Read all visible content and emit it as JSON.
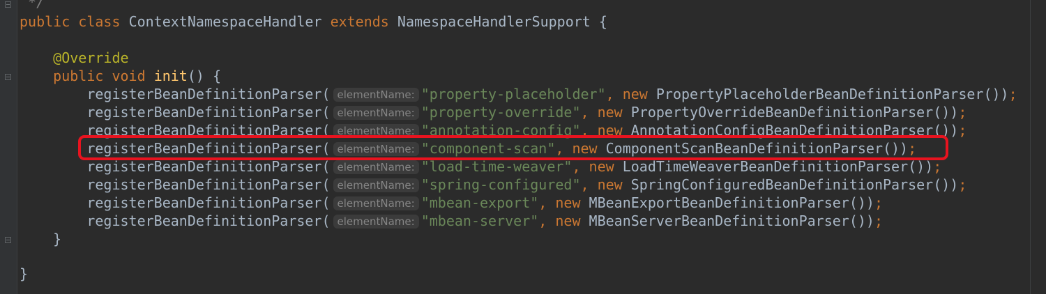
{
  "editor": {
    "lines": [
      {
        "kind": "comment",
        "text": " */"
      },
      {
        "kind": "class_decl",
        "kw_public": "public",
        "kw_class": "class",
        "class_name": "ContextNamespaceHandler",
        "kw_extends": "extends",
        "parent": "NamespaceHandlerSupport",
        "brace": "{"
      },
      {
        "kind": "blank"
      },
      {
        "kind": "annotation",
        "text": "@Override"
      },
      {
        "kind": "method_decl",
        "kw_public": "public",
        "kw_void": "void",
        "name": "init",
        "rest": "() {"
      },
      {
        "kind": "call",
        "method": "registerBeanDefinitionParser(",
        "hint": "elementName:",
        "arg": "\"property-placeholder\"",
        "comma": ",",
        "kw_new": "new",
        "ctor": "PropertyPlaceholderBeanDefinitionParser())",
        "semi": ";"
      },
      {
        "kind": "call",
        "method": "registerBeanDefinitionParser(",
        "hint": "elementName:",
        "arg": "\"property-override\"",
        "comma": ",",
        "kw_new": "new",
        "ctor": "PropertyOverrideBeanDefinitionParser())",
        "semi": ";"
      },
      {
        "kind": "call",
        "method": "registerBeanDefinitionParser(",
        "hint": "elementName:",
        "arg": "\"annotation-config\"",
        "comma": ",",
        "kw_new": "new",
        "ctor": "AnnotationConfigBeanDefinitionParser())",
        "semi": ";"
      },
      {
        "kind": "call",
        "method": "registerBeanDefinitionParser(",
        "hint": "elementName:",
        "arg": "\"component-scan\"",
        "comma": ",",
        "kw_new": "new",
        "ctor": "ComponentScanBeanDefinitionParser())",
        "semi": ";"
      },
      {
        "kind": "call",
        "method": "registerBeanDefinitionParser(",
        "hint": "elementName:",
        "arg": "\"load-time-weaver\"",
        "comma": ",",
        "kw_new": "new",
        "ctor": "LoadTimeWeaverBeanDefinitionParser())",
        "semi": ";"
      },
      {
        "kind": "call",
        "method": "registerBeanDefinitionParser(",
        "hint": "elementName:",
        "arg": "\"spring-configured\"",
        "comma": ",",
        "kw_new": "new",
        "ctor": "SpringConfiguredBeanDefinitionParser())",
        "semi": ";"
      },
      {
        "kind": "call",
        "method": "registerBeanDefinitionParser(",
        "hint": "elementName:",
        "arg": "\"mbean-export\"",
        "comma": ",",
        "kw_new": "new",
        "ctor": "MBeanExportBeanDefinitionParser())",
        "semi": ";"
      },
      {
        "kind": "call",
        "method": "registerBeanDefinitionParser(",
        "hint": "elementName:",
        "arg": "\"mbean-server\"",
        "comma": ",",
        "kw_new": "new",
        "ctor": "MBeanServerBeanDefinitionParser())",
        "semi": ";"
      },
      {
        "kind": "close",
        "text": "}"
      },
      {
        "kind": "blank"
      },
      {
        "kind": "close",
        "text": "}"
      }
    ]
  },
  "highlight": {
    "color": "#e8131f",
    "target_line": 8
  },
  "colors": {
    "background": "#2b2b2b",
    "keyword": "#cc7832",
    "string": "#6a8759",
    "annotation": "#bbb529",
    "method_name": "#ffc66d",
    "text": "#a9b7c6",
    "hint": "#858585"
  }
}
